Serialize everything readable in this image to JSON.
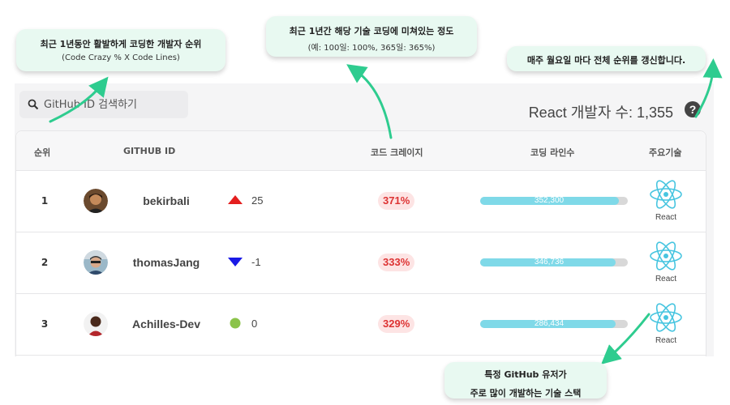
{
  "search": {
    "placeholder": "GitHub ID 검색하기"
  },
  "summary": {
    "count_text": "React 개발자 수: 1,355",
    "help_icon": "question-circle-icon",
    "help_glyph": "?"
  },
  "table": {
    "headers": {
      "rank": "순위",
      "github_id": "GITHUB ID",
      "code_crazy": "코드 크레이지",
      "code_lines": "코딩 라인수",
      "main_tech": "주요기술"
    },
    "rows": [
      {
        "rank": "1",
        "github_id": "bekirbali",
        "trend": "up",
        "change": "25",
        "code_crazy": "371%",
        "lines": "352,300",
        "lines_fraction": 0.94,
        "tech": "React",
        "tech_icon": "react-icon"
      },
      {
        "rank": "2",
        "github_id": "thomasJang",
        "trend": "down",
        "change": "-1",
        "code_crazy": "333%",
        "lines": "346,736",
        "lines_fraction": 0.92,
        "tech": "React",
        "tech_icon": "react-icon"
      },
      {
        "rank": "3",
        "github_id": "Achilles-Dev",
        "trend": "same",
        "change": "0",
        "code_crazy": "329%",
        "lines": "286,434",
        "lines_fraction": 0.92,
        "tech": "React",
        "tech_icon": "react-icon"
      }
    ]
  },
  "callouts": {
    "ranking": {
      "line1": "최근 1년동안 활발하게 코딩한 개발자 순위",
      "line2": "(Code Crazy % X Code Lines)"
    },
    "crazy": {
      "line1": "최근 1년간 해당 기술 코딩에 미쳐있는 정도",
      "line2": "(예: 100일: 100%, 365일: 365%)"
    },
    "update": {
      "line1": "매주 월요일 마다 전체 순위를 갱신합니다."
    },
    "tech": {
      "line1": "특정 GitHub 유저가",
      "line2": "주로 많이 개발하는 기술 스택"
    }
  },
  "colors": {
    "accent_arrow": "#2ecc8f",
    "crazy_text": "#dd3333",
    "bar_fill": "#7fd9e8",
    "up": "#e41e1e",
    "down": "#1a1ae6",
    "same": "#8bc34a"
  }
}
